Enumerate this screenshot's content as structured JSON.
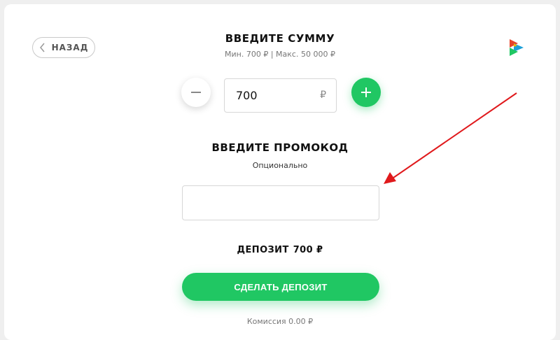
{
  "header": {
    "back_label": "НАЗАД",
    "title": "ВВЕДИТЕ СУММУ",
    "limits": "Мин. 700 ₽ | Макс. 50 000 ₽",
    "logo_icon": "brand-triangles-logo"
  },
  "amount": {
    "value": "700",
    "currency": "₽",
    "decrease_icon": "minus-icon",
    "increase_icon": "plus-icon"
  },
  "promo": {
    "title": "ВВЕДИТЕ ПРОМОКОД",
    "subtitle": "Опционально",
    "value": "",
    "placeholder": ""
  },
  "summary": {
    "label": "ДЕПОЗИТ",
    "amount": "700 ₽"
  },
  "submit": {
    "label": "СДЕЛАТЬ ДЕПОЗИТ"
  },
  "footer": {
    "commission": "Комиссия 0.00 ₽"
  },
  "colors": {
    "accent": "#20c763",
    "annotation_arrow": "#e0191c",
    "background": "#efefef",
    "card": "#ffffff"
  }
}
